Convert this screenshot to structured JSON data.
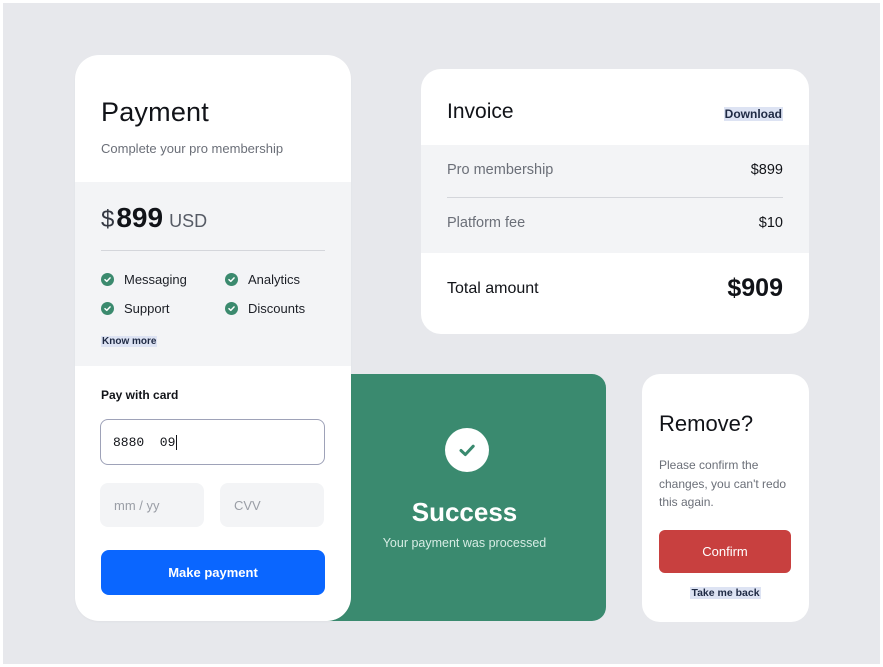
{
  "payment": {
    "title": "Payment",
    "subtitle": "Complete your pro membership",
    "currency_symbol": "$",
    "amount": "899",
    "currency_code": "USD",
    "features": [
      "Messaging",
      "Analytics",
      "Support",
      "Discounts"
    ],
    "know_more": "Know more",
    "pay_with_card": "Pay with card",
    "card_number_value": "8880  09",
    "expiry_placeholder": "mm / yy",
    "cvv_placeholder": "CVV",
    "make_payment": "Make payment"
  },
  "success": {
    "title": "Success",
    "message": "Your payment was processed"
  },
  "invoice": {
    "title": "Invoice",
    "download": "Download",
    "lines": [
      {
        "label": "Pro membership",
        "value": "$899"
      },
      {
        "label": "Platform fee",
        "value": "$10"
      }
    ],
    "total_label": "Total amount",
    "total_value": "$909"
  },
  "remove": {
    "title": "Remove?",
    "message": "Please confirm the changes, you can't redo this again.",
    "confirm": "Confirm",
    "back": "Take me back"
  },
  "colors": {
    "background": "#e7e8ec",
    "primary": "#0a66ff",
    "success": "#3a8a6f",
    "danger": "#c8403f",
    "check": "#3b8a6e"
  },
  "icons": {
    "feature": "check-circle-icon",
    "success": "check-circle-icon"
  }
}
